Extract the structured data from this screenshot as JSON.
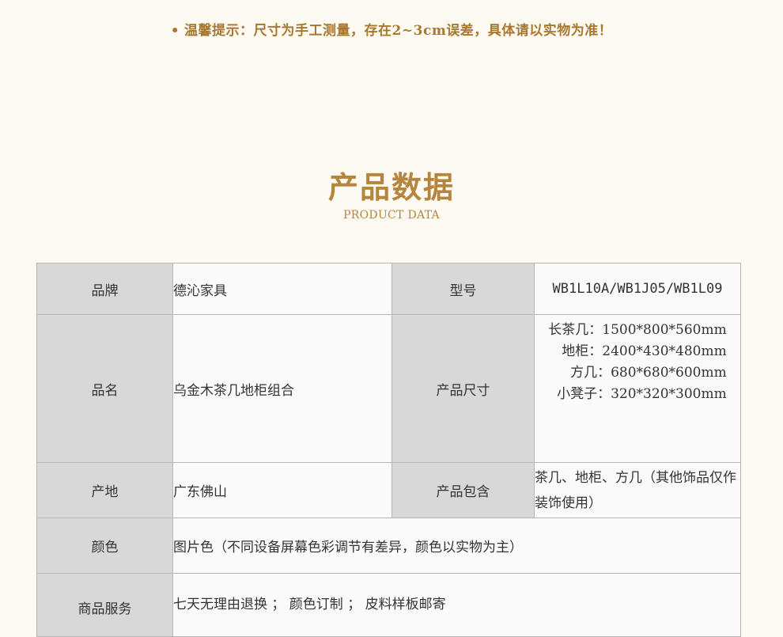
{
  "notice": {
    "bullet": "•",
    "text": "温馨提示：尺寸为手工测量，存在2~3cm误差，具体请以实物为准！"
  },
  "section": {
    "title": "产品数据",
    "subtitle": "PRODUCT DATA"
  },
  "spec": {
    "brand_label": "品牌",
    "brand_value": "德沁家具",
    "model_label": "型号",
    "model_value": "WB1L10A/WB1J05/WB1L09",
    "name_label": "品名",
    "name_value": "乌金木茶几地柜组合",
    "size_label": "产品尺寸",
    "sizes": [
      "长茶几：1500*800*560mm",
      "地柜：2400*430*480mm",
      "方几：680*680*600mm",
      "小凳子：320*320*300mm"
    ],
    "origin_label": "产地",
    "origin_value": "广东佛山",
    "includes_label": "产品包含",
    "includes_value": "茶几、地柜、方几（其他饰品仅作装饰使用）",
    "color_label": "颜色",
    "color_value": "图片色（不同设备屏幕色彩调节有差异，颜色以实物为主）",
    "service_label": "商品服务",
    "service_value": "七天无理由退换 ； 颜色订制 ； 皮料样板邮寄"
  }
}
